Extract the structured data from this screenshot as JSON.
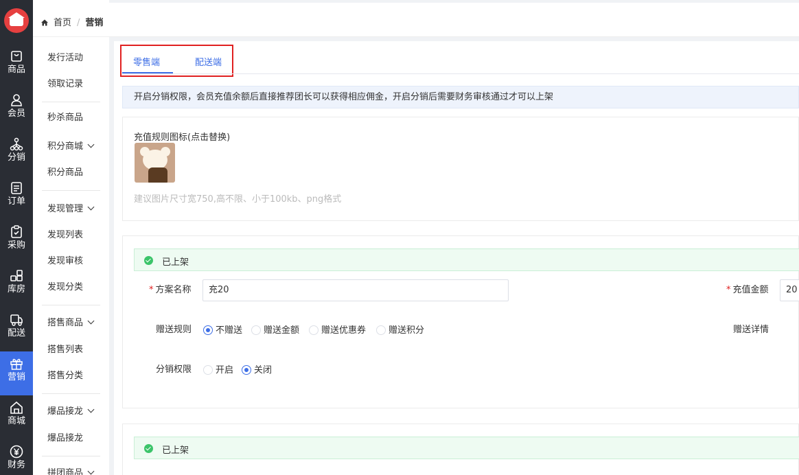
{
  "rail": {
    "items": [
      {
        "label": "商品",
        "icon": "bag-icon"
      },
      {
        "label": "会员",
        "icon": "user-icon"
      },
      {
        "label": "分销",
        "icon": "tree-icon"
      },
      {
        "label": "订单",
        "icon": "order-icon"
      },
      {
        "label": "采购",
        "icon": "clipboard-icon"
      },
      {
        "label": "库房",
        "icon": "grid-icon"
      },
      {
        "label": "配送",
        "icon": "truck-icon"
      },
      {
        "label": "营销",
        "icon": "gift-icon"
      },
      {
        "label": "商城",
        "icon": "home-icon"
      },
      {
        "label": "财务",
        "icon": "yen-icon"
      }
    ]
  },
  "submenu": {
    "items": [
      "发行活动",
      "领取记录",
      "秒杀商品",
      "积分商城",
      "积分商品",
      "发现管理",
      "发现列表",
      "发现审核",
      "发现分类",
      "搭售商品",
      "搭售列表",
      "搭售分类",
      "爆品接龙",
      "爆品接龙",
      "拼团商品"
    ]
  },
  "breadcrumb": {
    "home": "首页",
    "sep": "/",
    "current": "营销"
  },
  "tabs": [
    "零售端",
    "配送端"
  ],
  "notice": "开启分销权限，会员充值余额后直接推荐团长可以获得相应佣金，开启分销后需要财务审核通过才可以上架",
  "icon_card": {
    "title": "充值规则图标(点击替换)",
    "hint": "建议图片尺寸宽750,高不限、小于100kb、png格式"
  },
  "plan": {
    "status": "已上架",
    "name_label": "方案名称",
    "name_value": "充20",
    "amount_label": "充值金额",
    "amount_value": "20",
    "gift_label": "赠送规则",
    "gift_options": [
      "不赠送",
      "赠送金额",
      "赠送优惠券",
      "赠送积分"
    ],
    "gift_detail_label": "赠送详情",
    "dist_label": "分销权限",
    "dist_options": [
      "开启",
      "关闭"
    ]
  },
  "plan2": {
    "status": "已上架"
  },
  "colors": {
    "primary": "#3d6ee6",
    "rail": "#2a2d34",
    "success": "#3cc46a",
    "highlight": "#e02020"
  }
}
